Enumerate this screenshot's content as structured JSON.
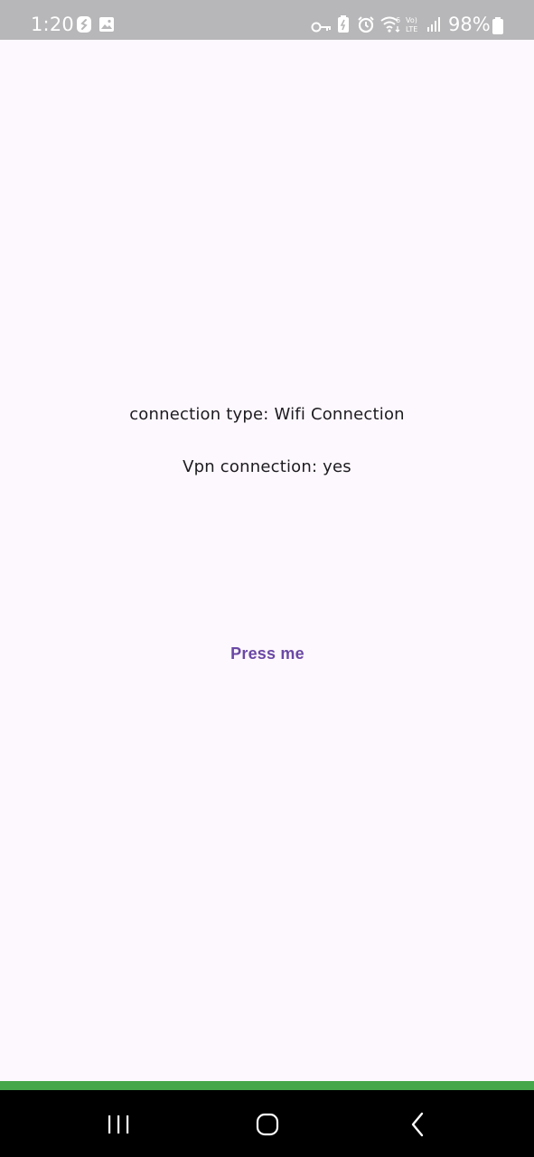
{
  "status_bar": {
    "time": "1:20",
    "battery_percent": "98%",
    "icons": [
      "shazam-icon",
      "gallery-icon",
      "vpn-key-icon",
      "battery-saver-icon",
      "alarm-icon",
      "wifi-6-icon",
      "volte-icon",
      "signal-icon",
      "battery-icon"
    ],
    "background_color": "#b7b6b8"
  },
  "main": {
    "connection_type_label": "connection type: Wifi Connection",
    "vpn_label": "Vpn connection: yes",
    "button_label": "Press me",
    "accent_color": "#6a48a5",
    "background_color": "#fdf8fd"
  },
  "nav_bar": {
    "buttons": [
      "recents-icon",
      "home-icon",
      "back-icon"
    ],
    "strip_color": "#46a64a"
  }
}
